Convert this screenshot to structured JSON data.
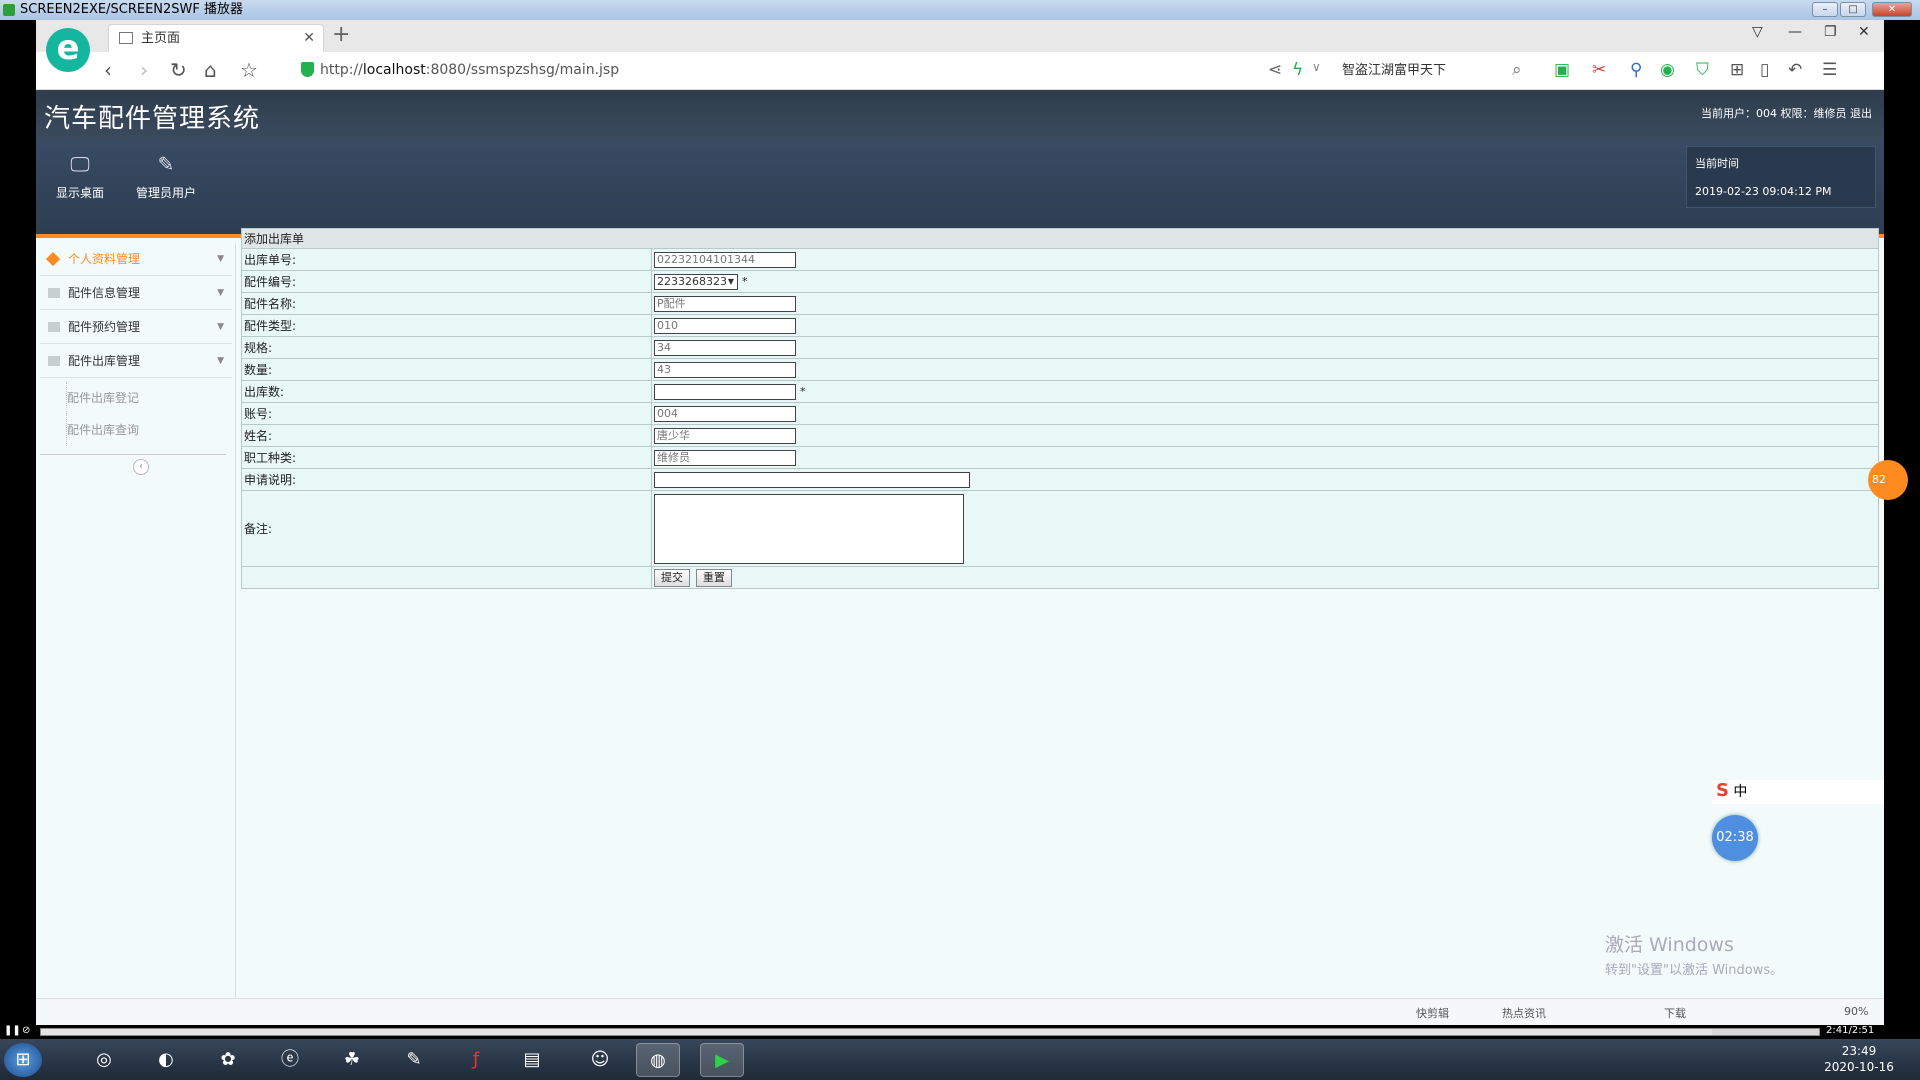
{
  "player": {
    "title": "SCREEN2EXE/SCREEN2SWF 播放器",
    "time": "2:41/2:51",
    "progress": 0.94
  },
  "browser": {
    "tab_title": "主页面",
    "url_scheme": "http://",
    "url_host": "localhost",
    "url_rest": ":8080/ssmspzshsg/main.jsp",
    "search_text": "智盗江湖富甲天下"
  },
  "app": {
    "title": "汽车配件管理系统",
    "user_info": "当前用户：004  权限：维修员  退出",
    "nav": [
      "显示桌面",
      "管理员用户"
    ],
    "time_label": "当前时间",
    "time_value": "2019-02-23 09:04:12 PM"
  },
  "sidebar": {
    "items": [
      "个人资料管理",
      "配件信息管理",
      "配件预约管理",
      "配件出库管理"
    ],
    "subitems": [
      "配件出库登记",
      "配件出库查询"
    ]
  },
  "form": {
    "caption": "添加出库单",
    "labels": {
      "order_no": "出库单号:",
      "part_no": "配件编号:",
      "part_name": "配件名称:",
      "part_type": "配件类型:",
      "spec": "规格:",
      "quantity": "数量:",
      "out_qty": "出库数:",
      "account": "账号:",
      "name": "姓名:",
      "staff_type": "职工种类:",
      "description": "申请说明:",
      "remark": "备注:"
    },
    "values": {
      "order_no": "02232104101344",
      "part_no": "2233268323",
      "part_name": "P配件",
      "part_type": "010",
      "spec": "34",
      "quantity": "43",
      "out_qty": "",
      "account": "004",
      "name": "唐少华",
      "staff_type": "维修员",
      "description": "",
      "remark": ""
    },
    "required_mark": "*",
    "submit": "提交",
    "reset": "重置"
  },
  "overlays": {
    "orange_badge": "82",
    "ime": "中",
    "timer": "02:38",
    "activate_title": "激活 Windows",
    "activate_sub": "转到\"设置\"以激活 Windows。"
  },
  "statusbar": {
    "items": [
      "快剪辑",
      "热点资讯",
      "下载"
    ],
    "zoom": "90%"
  },
  "clock": {
    "time": "23:49",
    "date": "2020-10-16"
  }
}
